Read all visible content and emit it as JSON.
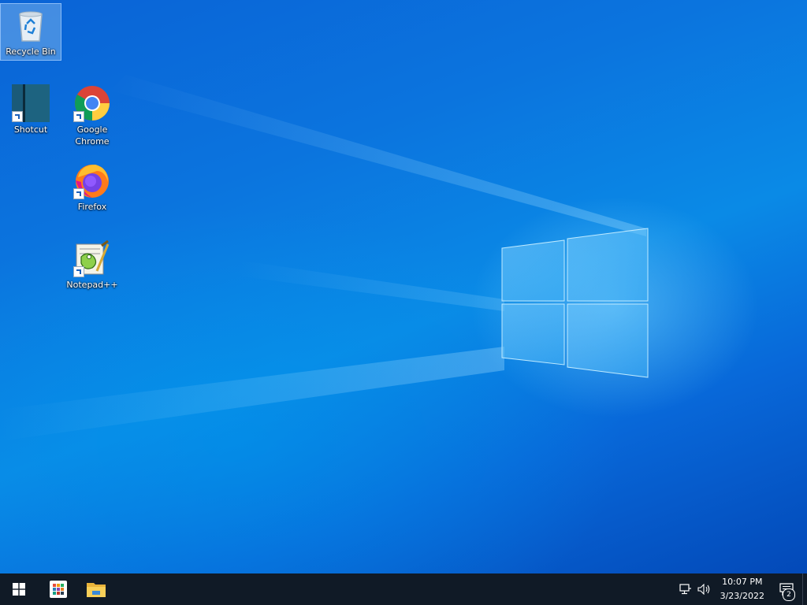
{
  "desktop": {
    "icons": [
      {
        "label": "Recycle Bin"
      },
      {
        "label": "Shotcut"
      },
      {
        "label": "Google Chrome"
      },
      {
        "label": "Firefox"
      },
      {
        "label": "Notepad++"
      }
    ]
  },
  "taskbar": {
    "start_icon": "windows-logo-icon",
    "pinned": [
      "apps-grid-icon",
      "file-explorer-icon"
    ],
    "tray": {
      "network_icon": "network-icon",
      "volume_icon": "volume-icon",
      "time": "10:07 PM",
      "date": "3/23/2022",
      "notification_count": "2"
    }
  },
  "colors": {
    "taskbar_bg": "#101a26",
    "desktop_accent": "#0a78dc"
  }
}
